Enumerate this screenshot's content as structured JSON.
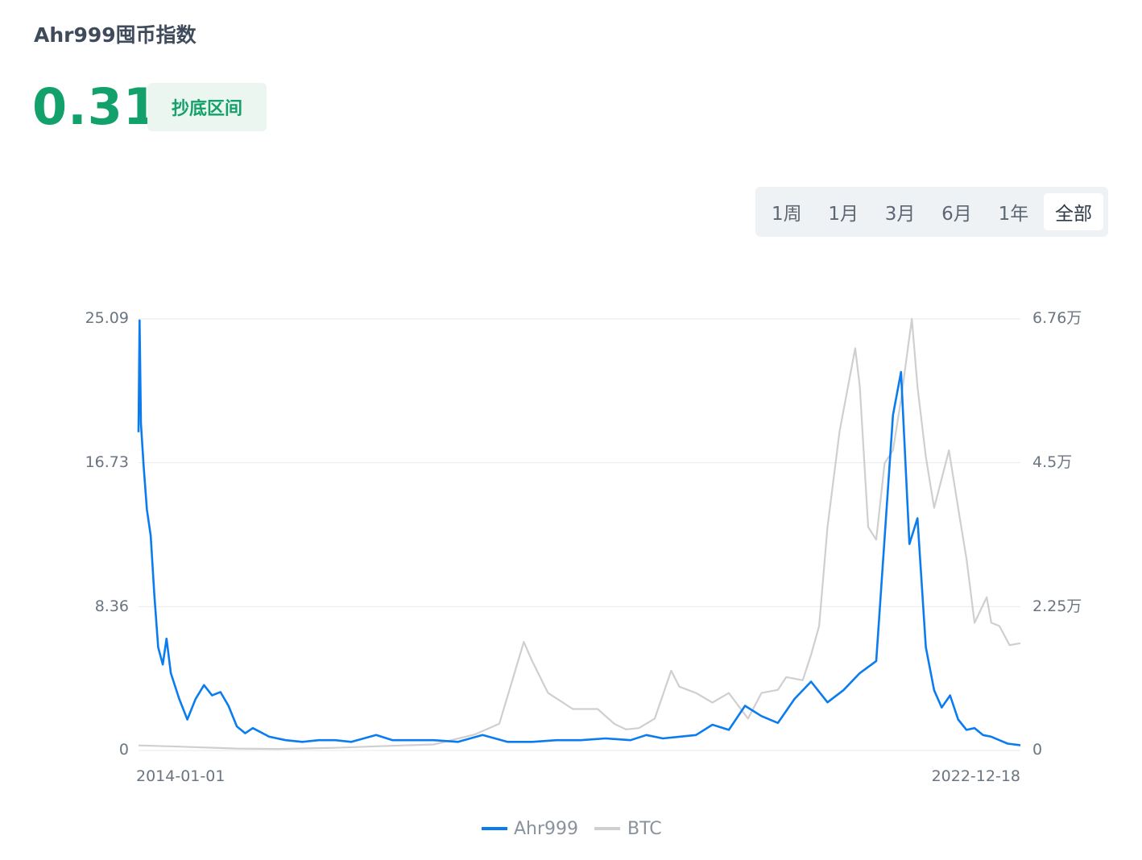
{
  "header": {
    "title": "Ahr999囤币指数",
    "value": "0.31",
    "badge": "抄底区间"
  },
  "range_selector": {
    "options": [
      "1周",
      "1月",
      "3月",
      "6月",
      "1年",
      "全部"
    ],
    "active": "全部"
  },
  "colors": {
    "ahr999": "#0a7cf0",
    "btc": "#cfcfcf",
    "value": "#12a16b",
    "grid": "#e6ebf0"
  },
  "chart_data": {
    "type": "line",
    "x_start": "2014-01-01",
    "x_end": "2022-12-18",
    "x_tick_labels": [
      "2014-01-01",
      "2022-12-18"
    ],
    "left_axis": {
      "ticks": [
        "0",
        "8.36",
        "16.73",
        "25.09"
      ],
      "range": [
        0,
        25.09
      ]
    },
    "right_axis": {
      "ticks": [
        "0",
        "2.25万",
        "4.5万",
        "6.76万"
      ],
      "range": [
        0,
        67600
      ]
    },
    "legend": [
      "Ahr999",
      "BTC"
    ],
    "grid": true,
    "series": [
      {
        "name": "Ahr999",
        "axis": "left",
        "points": [
          [
            "2014-01-01",
            18.5
          ],
          [
            "2014-01-05",
            25.0
          ],
          [
            "2014-01-10",
            19.0
          ],
          [
            "2014-01-20",
            16.5
          ],
          [
            "2014-02-01",
            14.0
          ],
          [
            "2014-02-15",
            12.5
          ],
          [
            "2014-03-01",
            9.0
          ],
          [
            "2014-03-15",
            6.0
          ],
          [
            "2014-04-01",
            5.0
          ],
          [
            "2014-04-15",
            6.5
          ],
          [
            "2014-05-01",
            4.5
          ],
          [
            "2014-06-01",
            3.0
          ],
          [
            "2014-07-01",
            1.8
          ],
          [
            "2014-08-01",
            3.0
          ],
          [
            "2014-09-01",
            3.8
          ],
          [
            "2014-10-01",
            3.2
          ],
          [
            "2014-11-01",
            3.4
          ],
          [
            "2014-12-01",
            2.6
          ],
          [
            "2015-01-01",
            1.4
          ],
          [
            "2015-02-01",
            1.0
          ],
          [
            "2015-03-01",
            1.3
          ],
          [
            "2015-05-01",
            0.8
          ],
          [
            "2015-07-01",
            0.6
          ],
          [
            "2015-09-01",
            0.5
          ],
          [
            "2015-11-01",
            0.6
          ],
          [
            "2016-01-01",
            0.6
          ],
          [
            "2016-03-01",
            0.5
          ],
          [
            "2016-06-01",
            0.9
          ],
          [
            "2016-08-01",
            0.6
          ],
          [
            "2016-10-01",
            0.6
          ],
          [
            "2017-01-01",
            0.6
          ],
          [
            "2017-04-01",
            0.5
          ],
          [
            "2017-07-01",
            0.9
          ],
          [
            "2017-10-01",
            0.5
          ],
          [
            "2018-01-01",
            0.5
          ],
          [
            "2018-04-01",
            0.6
          ],
          [
            "2018-07-01",
            0.6
          ],
          [
            "2018-10-01",
            0.7
          ],
          [
            "2019-01-01",
            0.6
          ],
          [
            "2019-03-01",
            0.9
          ],
          [
            "2019-05-01",
            0.7
          ],
          [
            "2019-07-01",
            0.8
          ],
          [
            "2019-09-01",
            0.9
          ],
          [
            "2019-11-01",
            1.5
          ],
          [
            "2020-01-01",
            1.2
          ],
          [
            "2020-03-01",
            2.6
          ],
          [
            "2020-05-01",
            2.0
          ],
          [
            "2020-07-01",
            1.6
          ],
          [
            "2020-09-01",
            3.0
          ],
          [
            "2020-11-01",
            4.0
          ],
          [
            "2021-01-01",
            2.8
          ],
          [
            "2021-03-01",
            3.5
          ],
          [
            "2021-05-01",
            4.5
          ],
          [
            "2021-07-01",
            5.2
          ],
          [
            "2021-09-01",
            19.5
          ],
          [
            "2021-10-01",
            22.0
          ],
          [
            "2021-11-01",
            12.0
          ],
          [
            "2021-12-01",
            13.5
          ],
          [
            "2022-01-01",
            6.0
          ],
          [
            "2022-02-01",
            3.5
          ],
          [
            "2022-03-01",
            2.5
          ],
          [
            "2022-04-01",
            3.2
          ],
          [
            "2022-05-01",
            1.8
          ],
          [
            "2022-06-01",
            1.2
          ],
          [
            "2022-07-01",
            1.3
          ],
          [
            "2022-08-01",
            0.9
          ],
          [
            "2022-09-01",
            0.8
          ],
          [
            "2022-10-01",
            0.6
          ],
          [
            "2022-11-01",
            0.4
          ],
          [
            "2022-12-18",
            0.31
          ]
        ]
      },
      {
        "name": "BTC",
        "axis": "right",
        "points": [
          [
            "2014-01-01",
            800
          ],
          [
            "2014-06-01",
            600
          ],
          [
            "2015-01-01",
            300
          ],
          [
            "2015-06-01",
            240
          ],
          [
            "2016-01-01",
            420
          ],
          [
            "2016-06-01",
            650
          ],
          [
            "2017-01-01",
            950
          ],
          [
            "2017-06-01",
            2500
          ],
          [
            "2017-09-01",
            4200
          ],
          [
            "2017-12-01",
            17000
          ],
          [
            "2018-01-01",
            14000
          ],
          [
            "2018-03-01",
            9000
          ],
          [
            "2018-06-01",
            6500
          ],
          [
            "2018-09-01",
            6500
          ],
          [
            "2018-11-01",
            4200
          ],
          [
            "2018-12-15",
            3300
          ],
          [
            "2019-02-01",
            3500
          ],
          [
            "2019-04-01",
            5000
          ],
          [
            "2019-06-01",
            12500
          ],
          [
            "2019-07-01",
            10000
          ],
          [
            "2019-09-01",
            9000
          ],
          [
            "2019-11-01",
            7500
          ],
          [
            "2020-01-01",
            9000
          ],
          [
            "2020-03-12",
            5000
          ],
          [
            "2020-05-01",
            9000
          ],
          [
            "2020-07-01",
            9500
          ],
          [
            "2020-08-01",
            11500
          ],
          [
            "2020-10-01",
            11000
          ],
          [
            "2020-11-01",
            15000
          ],
          [
            "2020-12-01",
            19500
          ],
          [
            "2021-01-01",
            35000
          ],
          [
            "2021-02-15",
            50000
          ],
          [
            "2021-04-14",
            63000
          ],
          [
            "2021-05-01",
            57000
          ],
          [
            "2021-06-01",
            35000
          ],
          [
            "2021-07-01",
            33000
          ],
          [
            "2021-08-01",
            45000
          ],
          [
            "2021-09-01",
            47000
          ],
          [
            "2021-10-01",
            55000
          ],
          [
            "2021-11-10",
            67600
          ],
          [
            "2021-12-01",
            57000
          ],
          [
            "2022-01-01",
            46000
          ],
          [
            "2022-02-01",
            38000
          ],
          [
            "2022-03-28",
            47000
          ],
          [
            "2022-05-01",
            38000
          ],
          [
            "2022-06-01",
            30000
          ],
          [
            "2022-07-01",
            20000
          ],
          [
            "2022-08-15",
            24000
          ],
          [
            "2022-09-01",
            20000
          ],
          [
            "2022-10-01",
            19500
          ],
          [
            "2022-11-08",
            16500
          ],
          [
            "2022-12-18",
            16800
          ]
        ]
      }
    ]
  }
}
